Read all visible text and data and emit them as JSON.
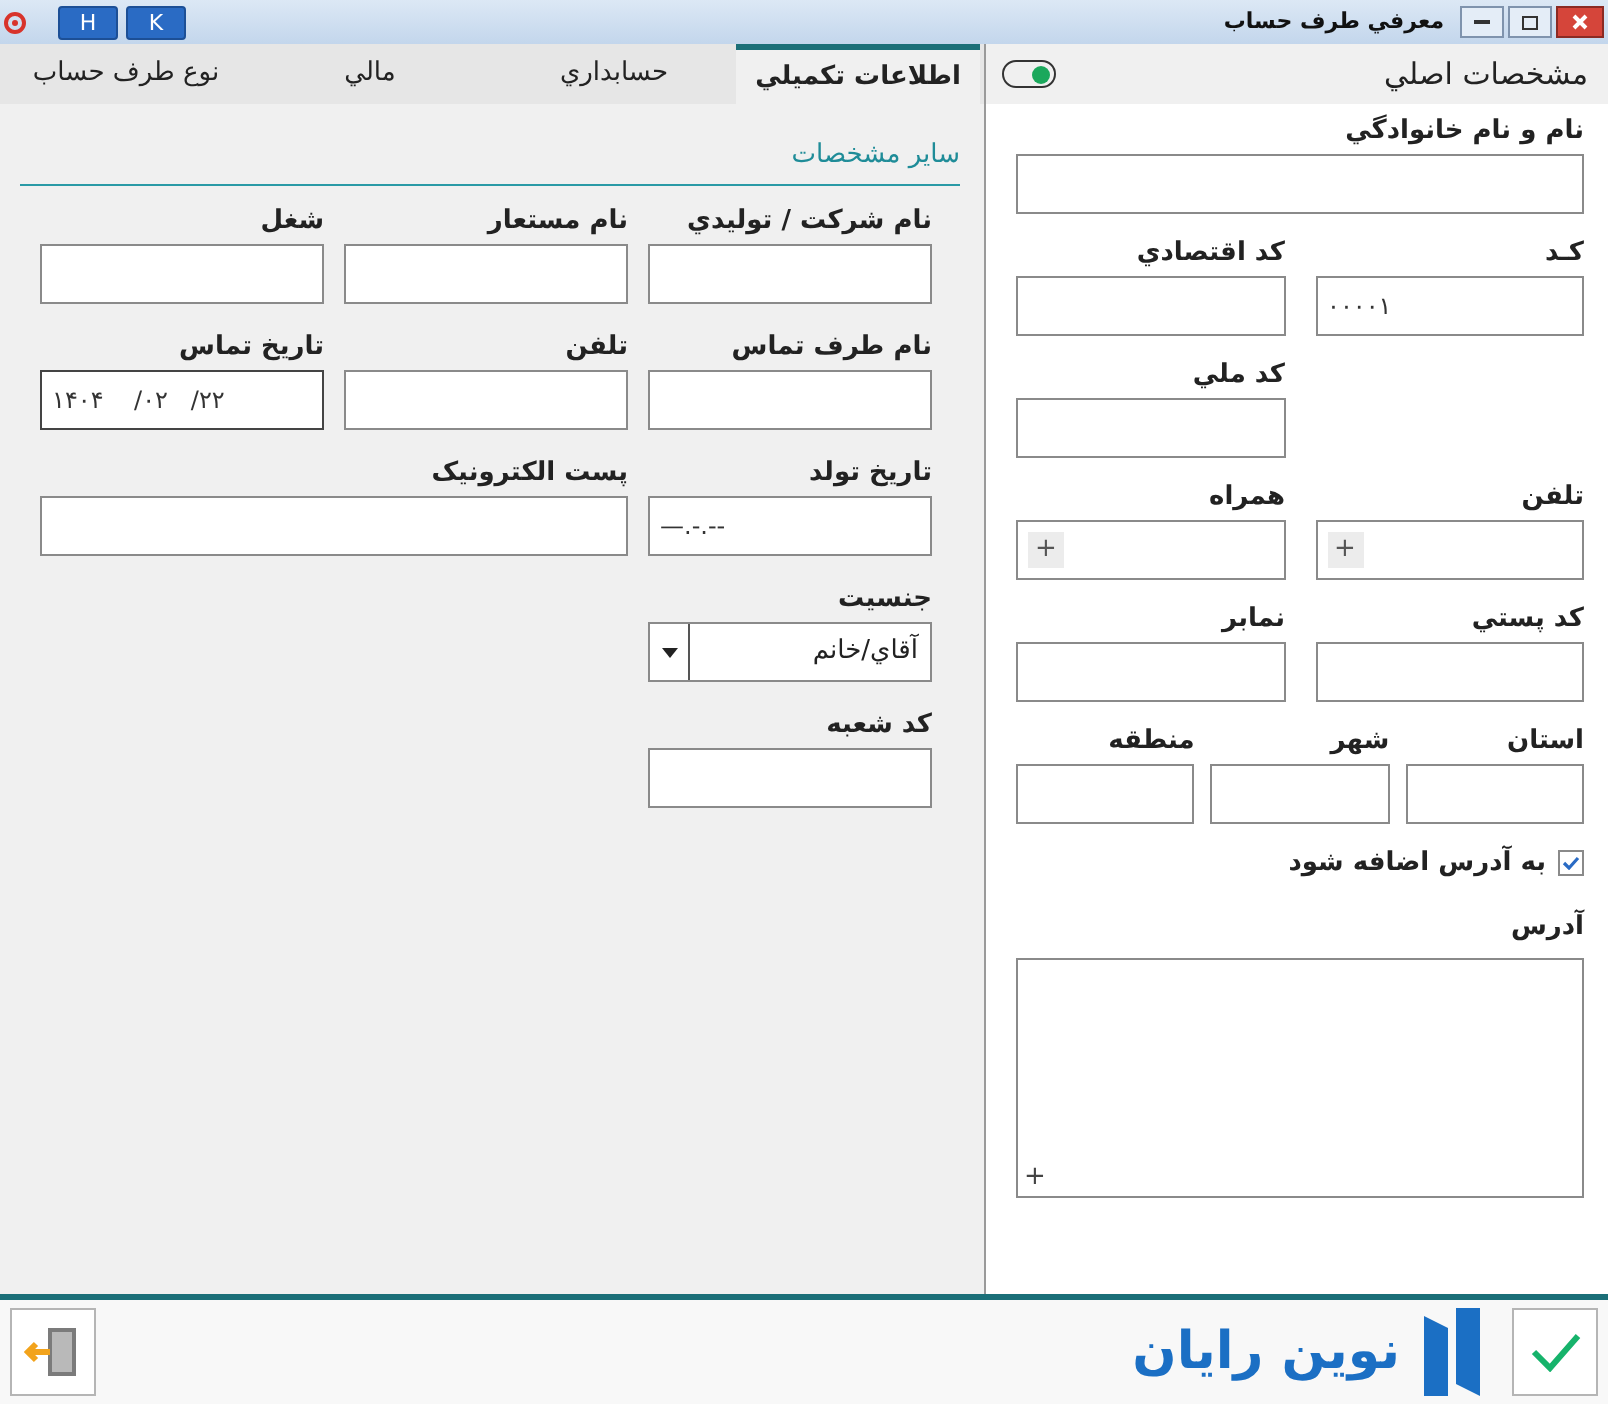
{
  "window": {
    "title": "معرفي طرف حساب",
    "buttons": [
      "K",
      "H"
    ]
  },
  "main_panel": {
    "title": "مشخصات اصلي",
    "toggle_on": true,
    "rows": [
      {
        "fields": [
          {
            "label": "نام و نام خانوادگي",
            "kind": "full"
          }
        ]
      },
      {
        "fields": [
          {
            "label": "کـد",
            "kind": "half",
            "value": "۰۰۰۰۱"
          },
          {
            "label": "کد اقتصادي",
            "kind": "half"
          }
        ]
      },
      {
        "fields": [
          {
            "label": "کد ملي",
            "kind": "half"
          }
        ]
      },
      {
        "fields": [
          {
            "label": "تلفن",
            "kind": "half",
            "button": "+"
          },
          {
            "label": "همراه",
            "kind": "half",
            "button": "+"
          }
        ]
      },
      {
        "fields": [
          {
            "label": "کد پستي",
            "kind": "half"
          },
          {
            "label": "نمابر",
            "kind": "half"
          }
        ]
      },
      {
        "fields": [
          {
            "label": "استان",
            "kind": "third"
          },
          {
            "label": "شهر",
            "kind": "third"
          },
          {
            "label": "منطقه",
            "kind": "third"
          }
        ]
      }
    ],
    "checkbox": {
      "label": "به آدرس اضافه شود",
      "checked": true
    },
    "address": {
      "label": "آدرس",
      "button": "+"
    }
  },
  "tabs": [
    {
      "label": "اطلاعات تکميلي",
      "selected": true
    },
    {
      "label": "حسابداري",
      "selected": false
    },
    {
      "label": "مالي",
      "selected": false
    },
    {
      "label": "نوع طرف حساب",
      "selected": false
    }
  ],
  "details": {
    "title": "ساير مشخصات",
    "rows": [
      {
        "fields": [
          {
            "label": "نام شرکت / توليدي",
            "kind": "text"
          },
          {
            "label": "نام مستعار",
            "kind": "text"
          },
          {
            "label": "شغل",
            "kind": "text"
          }
        ]
      },
      {
        "fields": [
          {
            "label": "نام طرف تماس",
            "kind": "text"
          },
          {
            "label": "تلفن",
            "kind": "text"
          },
          {
            "label": "تاريخ تماس",
            "kind": "date",
            "value": "۱۴۰۴    /۰۲   /۲۲"
          }
        ]
      },
      {
        "fields": [
          {
            "label": "تاريخ تولد",
            "kind": "date",
            "value": "—.-.--"
          },
          {
            "label": "پست الکترونيک",
            "kind": "wide"
          }
        ]
      },
      {
        "fields": [
          {
            "label": "جنسيت",
            "kind": "select",
            "value": "آقاي/خانم"
          }
        ]
      },
      {
        "fields": [
          {
            "label": "کد شعبه",
            "kind": "text"
          }
        ]
      }
    ]
  },
  "footer": {
    "brand": "نوين رايان"
  }
}
